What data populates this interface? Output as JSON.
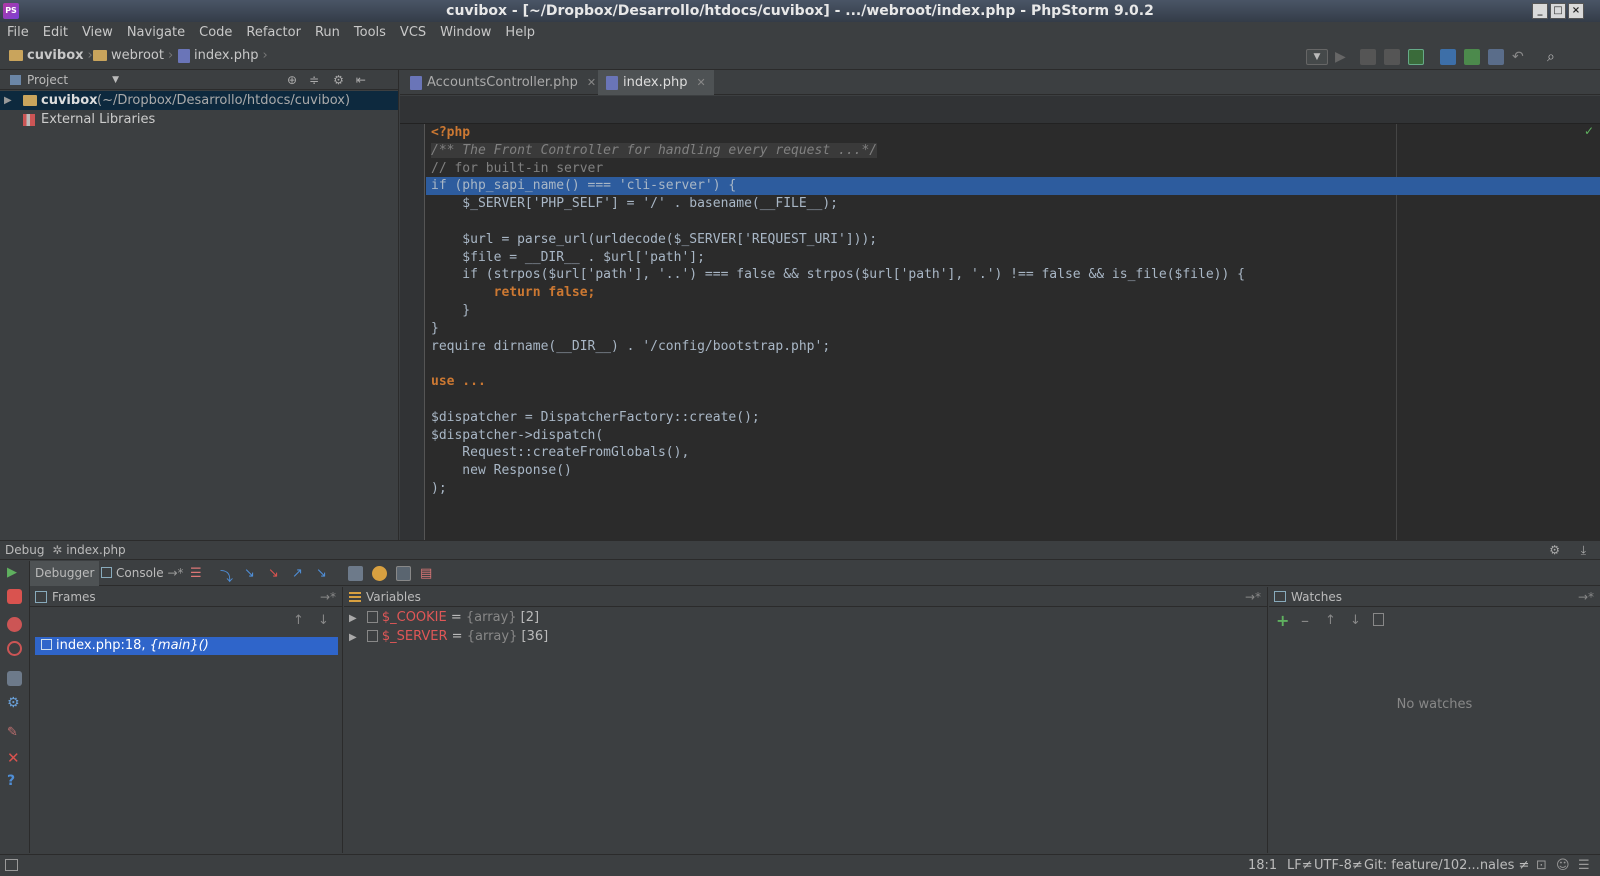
{
  "window": {
    "title": "cuvibox - [~/Dropbox/Desarrollo/htdocs/cuvibox] - .../webroot/index.php - PhpStorm 9.0.2"
  },
  "menu": [
    "File",
    "Edit",
    "View",
    "Navigate",
    "Code",
    "Refactor",
    "Run",
    "Tools",
    "VCS",
    "Window",
    "Help"
  ],
  "nav": {
    "project": "cuvibox",
    "folder": "webroot",
    "file": "index.php"
  },
  "project_pane": {
    "title": "Project",
    "root_name": "cuvibox",
    "root_path": "(~/Dropbox/Desarrollo/htdocs/cuvibox)",
    "external": "External Libraries"
  },
  "editor_tabs": [
    "AccountsController.php",
    "index.php"
  ],
  "code_lines": [
    "<?php",
    "/** The Front Controller for handling every request ...*/",
    "// for built-in server",
    "if (php_sapi_name() === 'cli-server') {",
    "    $_SERVER['PHP_SELF'] = '/' . basename(__FILE__);",
    "",
    "    $url = parse_url(urldecode($_SERVER['REQUEST_URI']));",
    "    $file = __DIR__ . $url['path'];",
    "    if (strpos($url['path'], '..') === false && strpos($url['path'], '.') !== false && is_file($file)) {",
    "        return false;",
    "    }",
    "}",
    "require dirname(__DIR__) . '/config/bootstrap.php';",
    "",
    "use ...",
    "",
    "$dispatcher = DispatcherFactory::create();",
    "$dispatcher->dispatch(",
    "    Request::createFromGlobals(),",
    "    new Response()",
    ");"
  ],
  "debug": {
    "label": "Debug",
    "config": "index.php",
    "tab_debugger": "Debugger",
    "tab_console": "Console",
    "frames_title": "Frames",
    "frame": "index.php:18,",
    "frame_fn": "{main}()",
    "variables_title": "Variables",
    "vars": [
      {
        "name": "$_COOKIE",
        "eq": " = ",
        "type": "{array}",
        "count": " [2]"
      },
      {
        "name": "$_SERVER",
        "eq": " = ",
        "type": "{array}",
        "count": " [36]"
      }
    ],
    "watches_title": "Watches",
    "no_watches": "No watches"
  },
  "status": {
    "position": "18:1",
    "line_sep": "LF≠",
    "encoding": "UTF-8≠",
    "git": "Git: feature/102...nales ≠"
  }
}
